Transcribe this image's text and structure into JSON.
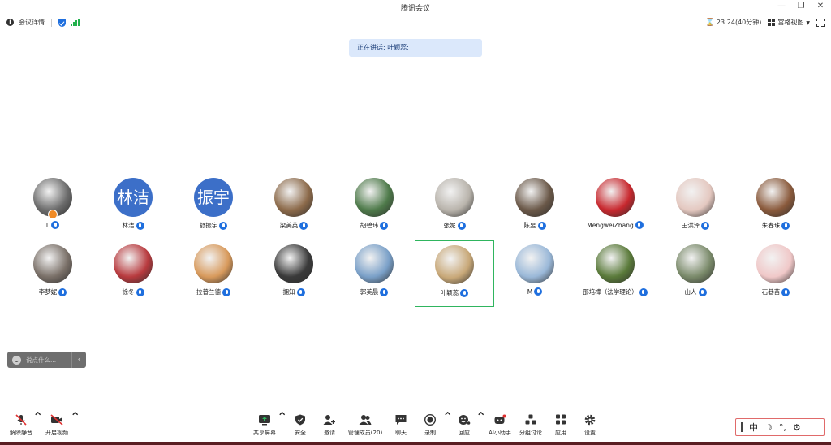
{
  "window": {
    "title": "腾讯会议"
  },
  "infobar": {
    "meeting_info_label": "会议详情",
    "timer": "23:24(40分钟)",
    "view_label": "宫格视图"
  },
  "speaking": {
    "text": "正在讲话: 叶颖蕊;"
  },
  "participants": [
    {
      "name": "L",
      "avatar_text": "",
      "color": "#6b6b6b"
    },
    {
      "name": "林洁",
      "avatar_text": "林洁",
      "color": "#3c6fc8"
    },
    {
      "name": "舒振宇",
      "avatar_text": "振宇",
      "color": "#3c6fc8"
    },
    {
      "name": "梁美英",
      "avatar_text": "",
      "color": "#8c6a4a"
    },
    {
      "name": "胡碧玮",
      "avatar_text": "",
      "color": "#4e7a4a"
    },
    {
      "name": "张妮",
      "avatar_text": "",
      "color": "#b9b4ac"
    },
    {
      "name": "陈昱",
      "avatar_text": "",
      "color": "#6a5848"
    },
    {
      "name": "MengweiZhang",
      "avatar_text": "",
      "color": "#c8282e"
    },
    {
      "name": "王洪泽",
      "avatar_text": "",
      "color": "#e4c8c0"
    },
    {
      "name": "朱春珠",
      "avatar_text": "",
      "color": "#8a5a3c"
    },
    {
      "name": "李梦妮",
      "avatar_text": "",
      "color": "#7a7068"
    },
    {
      "name": "徐冬",
      "avatar_text": "",
      "color": "#b83a3e"
    },
    {
      "name": "拉普兰德",
      "avatar_text": "",
      "color": "#d89a5c"
    },
    {
      "name": "拥知",
      "avatar_text": "",
      "color": "#3a3a3a"
    },
    {
      "name": "郭美晨",
      "avatar_text": "",
      "color": "#7aa0c8"
    },
    {
      "name": "叶颖蕊",
      "avatar_text": "",
      "color": "#c8a878"
    },
    {
      "name": "M",
      "avatar_text": "",
      "color": "#9ab8d8"
    },
    {
      "name": "邵培樟（法学理论）",
      "avatar_text": "",
      "color": "#5a7a3a"
    },
    {
      "name": "山人",
      "avatar_text": "",
      "color": "#7a8a6a"
    },
    {
      "name": "石巷苗",
      "avatar_text": "",
      "color": "#f0c8c8"
    }
  ],
  "chat": {
    "placeholder": "说点什么..."
  },
  "toolbar": {
    "unmute": "解除静音",
    "start_video": "开启视频",
    "share_screen": "共享屏幕",
    "security": "安全",
    "invite": "邀请",
    "manage_members": "管理成员(20)",
    "chat": "聊天",
    "record": "录制",
    "reactions": "回应",
    "ai_assistant": "AI小助手",
    "breakout": "分组讨论",
    "apps": "应用",
    "settings": "设置"
  },
  "ime": {
    "mode": "中"
  },
  "colors": {
    "accent": "#1f6fde",
    "active_border": "#2fb55e",
    "signal": "#22b14c"
  }
}
